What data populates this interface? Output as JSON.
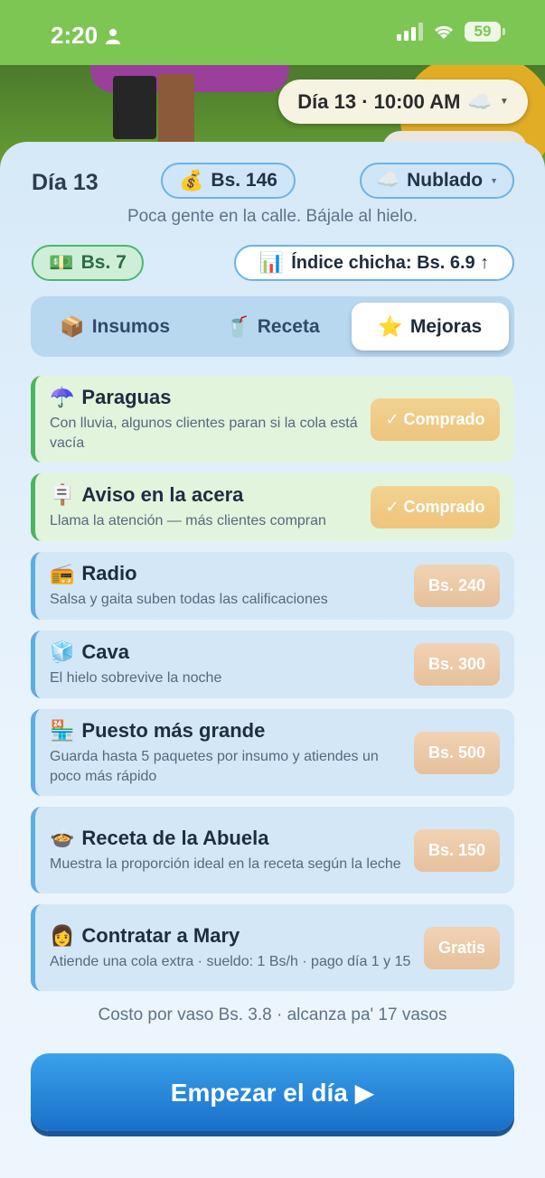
{
  "status": {
    "time": "2:20",
    "battery": "59"
  },
  "scene": {
    "time_pill": "Día 13 · 10:00 AM",
    "weather_icon": "cloud"
  },
  "header": {
    "day": "Día 13",
    "money": "Bs. 146",
    "weather": "Nublado",
    "subtitle": "Poca gente en la calle. Bájale al hielo.",
    "cash": "Bs. 7",
    "index": "Índice chicha: Bs. 6.9 ↑"
  },
  "tabs": [
    {
      "label": "Insumos",
      "icon": "📦"
    },
    {
      "label": "Receta",
      "icon": "🥤"
    },
    {
      "label": "Mejoras",
      "icon": "⭐"
    }
  ],
  "upgrades": [
    {
      "icon": "☂️",
      "title": "Paraguas",
      "desc": "Con lluvia, algunos clientes paran si la cola está vacía",
      "button": "✓ Comprado",
      "owned": true
    },
    {
      "icon": "🪧",
      "title": "Aviso en la acera",
      "desc": "Llama la atención — más clientes compran",
      "button": "✓ Comprado",
      "owned": true
    },
    {
      "icon": "📻",
      "title": "Radio",
      "desc": "Salsa y gaita suben todas las calificaciones",
      "button": "Bs. 240",
      "owned": false
    },
    {
      "icon": "🧊",
      "title": "Cava",
      "desc": "El hielo sobrevive la noche",
      "button": "Bs. 300",
      "owned": false
    },
    {
      "icon": "🏪",
      "title": "Puesto más grande",
      "desc": "Guarda hasta 5 paquetes por insumo y atiendes un poco más rápido",
      "button": "Bs. 500",
      "owned": false
    },
    {
      "icon": "🍲",
      "title": "Receta de la Abuela",
      "desc": "Muestra la proporción ideal en la receta según la leche",
      "button": "Bs. 150",
      "owned": false
    },
    {
      "icon": "👩",
      "title": "Contratar a Mary",
      "desc": "Atiende una cola extra · sueldo: 1 Bs/h · pago día 1 y 15",
      "button": "Gratis",
      "owned": false
    }
  ],
  "footer": {
    "cost_text": "Costo por vaso Bs. 3.8 · alcanza pa' 17 vasos",
    "start_button": "Empezar el día ▶"
  }
}
